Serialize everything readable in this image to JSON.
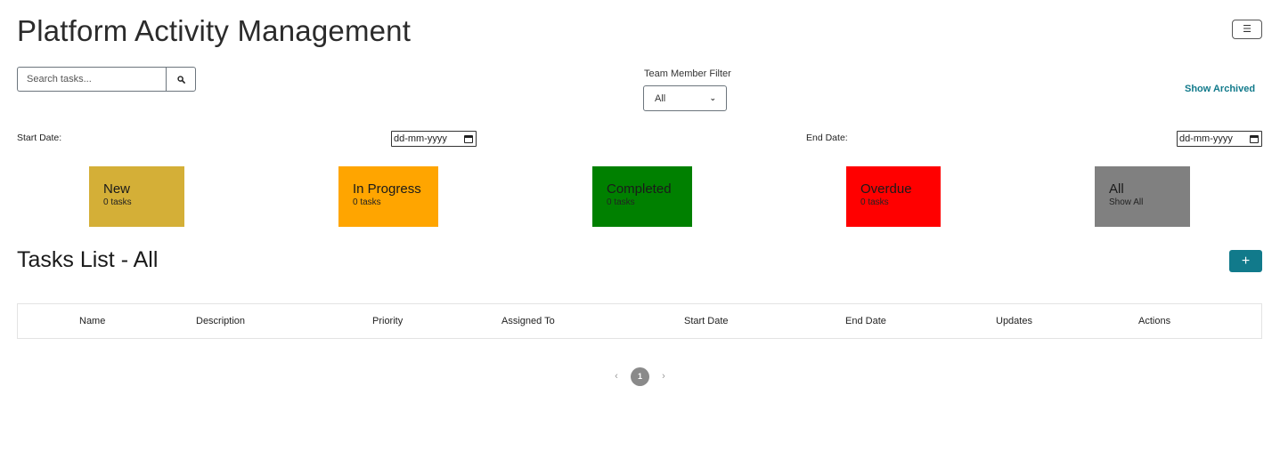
{
  "header": {
    "title": "Platform Activity Management",
    "menu_icon": "hamburger-icon"
  },
  "search": {
    "placeholder": "Search tasks...",
    "value": "",
    "icon": "search-icon"
  },
  "filter": {
    "label": "Team Member Filter",
    "selected": "All"
  },
  "show_archived_label": "Show Archived",
  "dates": {
    "start_label": "Start Date:",
    "start_placeholder": "dd-mm-yyyy",
    "end_label": "End Date:",
    "end_placeholder": "dd-mm-yyyy"
  },
  "status_cards": [
    {
      "title": "New",
      "subtitle": "0 tasks",
      "color": "#d4af37"
    },
    {
      "title": "In Progress",
      "subtitle": "0 tasks",
      "color": "#ffa500"
    },
    {
      "title": "Completed",
      "subtitle": "0 tasks",
      "color": "#008000"
    },
    {
      "title": "Overdue",
      "subtitle": "0 tasks",
      "color": "#ff0000"
    },
    {
      "title": "All",
      "subtitle": "Show All",
      "color": "#808080"
    }
  ],
  "tasks_list": {
    "title": "Tasks List - All",
    "add_label": "+",
    "columns": [
      "Name",
      "Description",
      "Priority",
      "Assigned To",
      "Start Date",
      "End Date",
      "Updates",
      "Actions"
    ],
    "rows": []
  },
  "pagination": {
    "prev": "‹",
    "current_page": "1",
    "next": "›"
  },
  "colors": {
    "accent": "#117a8b"
  }
}
